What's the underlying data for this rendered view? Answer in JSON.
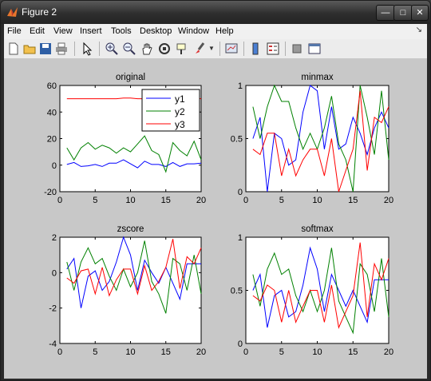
{
  "window": {
    "title": "Figure 2"
  },
  "menubar": {
    "items": [
      "File",
      "Edit",
      "View",
      "Insert",
      "Tools",
      "Desktop",
      "Window",
      "Help"
    ]
  },
  "toolbar": {
    "icons": [
      "new-file-icon",
      "open-folder-icon",
      "save-icon",
      "print-icon",
      "pointer-icon",
      "zoom-in-icon",
      "zoom-out-icon",
      "pan-hand-icon",
      "rotate-3d-icon",
      "data-cursor-icon",
      "brush-icon",
      "link-plot-icon",
      "colorbar-icon",
      "legend-icon",
      "hide-plot-tools-icon",
      "show-plot-tools-icon"
    ]
  },
  "colors": {
    "y1": "#0000ff",
    "y2": "#008000",
    "y3": "#ff0000"
  },
  "chart_data": [
    {
      "type": "line",
      "title": "original",
      "x": [
        1,
        2,
        3,
        4,
        5,
        6,
        7,
        8,
        9,
        10,
        11,
        12,
        13,
        14,
        15,
        16,
        17,
        18,
        19,
        20
      ],
      "xlim": [
        0,
        20
      ],
      "ylim": [
        -20,
        60
      ],
      "xticks": [
        0,
        5,
        10,
        15,
        20
      ],
      "yticks": [
        -20,
        0,
        20,
        40,
        60
      ],
      "legend": {
        "placement": "top-right",
        "entries": [
          "y1",
          "y2",
          "y3"
        ]
      },
      "series": [
        {
          "name": "y1",
          "values": [
            0.5,
            2,
            -1,
            -0.5,
            0.5,
            -1,
            1.5,
            1.5,
            4,
            1,
            -2,
            3,
            0.5,
            0.5,
            -1,
            2,
            -1,
            1,
            1,
            1.5
          ]
        },
        {
          "name": "y2",
          "values": [
            13,
            4,
            13,
            17,
            12,
            15,
            13,
            9,
            13,
            10,
            16,
            22,
            11,
            8,
            -5,
            17,
            11,
            7,
            18,
            4
          ]
        },
        {
          "name": "y3",
          "values": [
            50,
            50,
            50,
            50,
            50,
            50,
            50,
            50,
            50.5,
            50.5,
            50,
            50,
            50.5,
            50,
            50,
            51,
            50,
            50.5,
            50.5,
            50
          ]
        }
      ]
    },
    {
      "type": "line",
      "title": "minmax",
      "x": [
        1,
        2,
        3,
        4,
        5,
        6,
        7,
        8,
        9,
        10,
        11,
        12,
        13,
        14,
        15,
        16,
        17,
        18,
        19,
        20
      ],
      "xlim": [
        0,
        20
      ],
      "ylim": [
        0,
        1
      ],
      "xticks": [
        0,
        5,
        10,
        15,
        20
      ],
      "yticks": [
        0,
        0.5,
        1
      ],
      "series": [
        {
          "name": "y1",
          "values": [
            0.5,
            0.7,
            0,
            0.55,
            0.5,
            0.25,
            0.3,
            0.75,
            1,
            0.95,
            0.4,
            0.8,
            0.4,
            0.45,
            0.7,
            0.55,
            0.35,
            0.6,
            0.75,
            0.6
          ]
        },
        {
          "name": "y2",
          "values": [
            0.8,
            0.5,
            0.8,
            1,
            0.85,
            0.85,
            0.6,
            0.4,
            0.55,
            0.4,
            0.6,
            0.9,
            0.45,
            0.3,
            0,
            1,
            0.7,
            0.35,
            0.95,
            0.3
          ]
        },
        {
          "name": "y3",
          "values": [
            0.4,
            0.35,
            0.55,
            0.55,
            0.15,
            0.4,
            0.15,
            0.3,
            0.4,
            0.4,
            0.15,
            0.5,
            0,
            0.2,
            0.4,
            0.95,
            0.2,
            0.7,
            0.65,
            0.8
          ]
        }
      ]
    },
    {
      "type": "line",
      "title": "zscore",
      "x": [
        1,
        2,
        3,
        4,
        5,
        6,
        7,
        8,
        9,
        10,
        11,
        12,
        13,
        14,
        15,
        16,
        17,
        18,
        19,
        20
      ],
      "xlim": [
        0,
        20
      ],
      "ylim": [
        -4,
        2
      ],
      "xticks": [
        0,
        5,
        10,
        15,
        20
      ],
      "yticks": [
        -4,
        -2,
        0,
        2
      ],
      "series": [
        {
          "name": "y1",
          "values": [
            0.2,
            0.8,
            -2,
            -0.2,
            0.1,
            -1,
            -0.5,
            0.6,
            2,
            1,
            -1,
            0.7,
            0,
            -0.6,
            0.3,
            -0.6,
            -1.5,
            0.5,
            0.5,
            0.5
          ]
        },
        {
          "name": "y2",
          "values": [
            0.6,
            -1,
            0.6,
            1.4,
            0.5,
            0.8,
            -0.2,
            -1,
            0.2,
            -0.8,
            0,
            1.8,
            -0.5,
            -1.2,
            -2.3,
            0.8,
            0.5,
            -1,
            1,
            -1.2
          ]
        },
        {
          "name": "y3",
          "values": [
            -0.3,
            -0.6,
            0.1,
            0.2,
            -1.2,
            0.3,
            -1.3,
            -0.4,
            0.2,
            0.2,
            -1.2,
            0.4,
            -1,
            -0.5,
            0.3,
            1.9,
            -0.9,
            0.9,
            0.5,
            1.4
          ]
        }
      ]
    },
    {
      "type": "line",
      "title": "softmax",
      "x": [
        1,
        2,
        3,
        4,
        5,
        6,
        7,
        8,
        9,
        10,
        11,
        12,
        13,
        14,
        15,
        16,
        17,
        18,
        19,
        20
      ],
      "xlim": [
        0,
        20
      ],
      "ylim": [
        0,
        1
      ],
      "xticks": [
        0,
        5,
        10,
        15,
        20
      ],
      "yticks": [
        0,
        0.5,
        1
      ],
      "series": [
        {
          "name": "y1",
          "values": [
            0.5,
            0.65,
            0.15,
            0.45,
            0.5,
            0.25,
            0.3,
            0.55,
            0.9,
            0.7,
            0.3,
            0.65,
            0.5,
            0.35,
            0.5,
            0.35,
            0.2,
            0.6,
            0.6,
            0.6
          ]
        },
        {
          "name": "y2",
          "values": [
            0.65,
            0.35,
            0.7,
            0.85,
            0.65,
            0.7,
            0.45,
            0.3,
            0.5,
            0.3,
            0.5,
            0.9,
            0.4,
            0.25,
            0.1,
            0.75,
            0.65,
            0.3,
            0.8,
            0.25
          ]
        },
        {
          "name": "y3",
          "values": [
            0.45,
            0.4,
            0.55,
            0.5,
            0.2,
            0.5,
            0.2,
            0.35,
            0.5,
            0.5,
            0.2,
            0.55,
            0.15,
            0.3,
            0.45,
            0.95,
            0.25,
            0.75,
            0.6,
            0.8
          ]
        }
      ]
    }
  ]
}
